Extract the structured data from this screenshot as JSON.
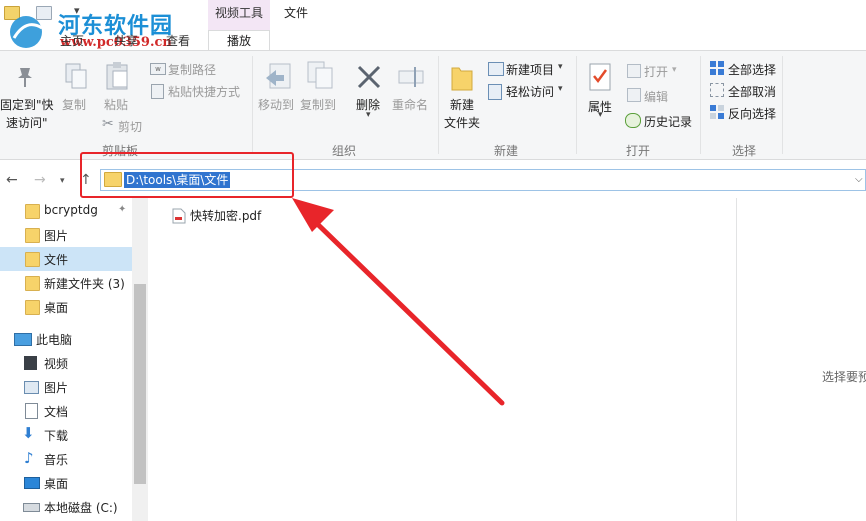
{
  "titlebar": {
    "context_group": "视频工具",
    "context_tab": "播放",
    "file_menu": "文件",
    "tabs": [
      "主页",
      "共享",
      "查看"
    ],
    "watermark": "河东软件园",
    "watermark_url": "www.pc0359.cn"
  },
  "ribbon": {
    "clipboard": {
      "group": "剪贴板",
      "pin_line1": "固定到\"快",
      "pin_line2": "速访问\"",
      "copy": "复制",
      "paste": "粘贴",
      "copy_path": "复制路径",
      "paste_shortcut": "粘贴快捷方式",
      "cut": "剪切"
    },
    "organize": {
      "group": "组织",
      "move_to": "移动到",
      "copy_to": "复制到",
      "delete": "删除",
      "rename": "重命名"
    },
    "new": {
      "group": "新建",
      "new_folder_line1": "新建",
      "new_folder_line2": "文件夹",
      "new_item": "新建项目",
      "easy_access": "轻松访问"
    },
    "open": {
      "group": "打开",
      "properties": "属性",
      "open": "打开",
      "edit": "编辑",
      "history": "历史记录"
    },
    "select": {
      "group": "选择",
      "select_all": "全部选择",
      "select_none": "全部取消",
      "invert": "反向选择"
    }
  },
  "address": {
    "path": "D:\\tools\\桌面\\文件"
  },
  "nav_pane": {
    "quick": [
      {
        "label": "bcryptdg"
      },
      {
        "label": "图片"
      },
      {
        "label": "文件"
      },
      {
        "label": "新建文件夹 (3)"
      },
      {
        "label": "桌面"
      }
    ],
    "this_pc": "此电脑",
    "pc_items": [
      {
        "label": "视频",
        "icon": "video-icon"
      },
      {
        "label": "图片",
        "icon": "pictures-icon"
      },
      {
        "label": "文档",
        "icon": "documents-icon"
      },
      {
        "label": "下载",
        "icon": "download-icon"
      },
      {
        "label": "音乐",
        "icon": "music-icon"
      },
      {
        "label": "桌面",
        "icon": "desktop-icon"
      },
      {
        "label": "本地磁盘 (C:)",
        "icon": "drive-icon"
      }
    ]
  },
  "content": {
    "files": [
      {
        "name": "快转加密.pdf"
      }
    ],
    "preview_hint": "选择要预"
  },
  "colors": {
    "accent": "#3074cf",
    "annotation": "#e8252a"
  }
}
